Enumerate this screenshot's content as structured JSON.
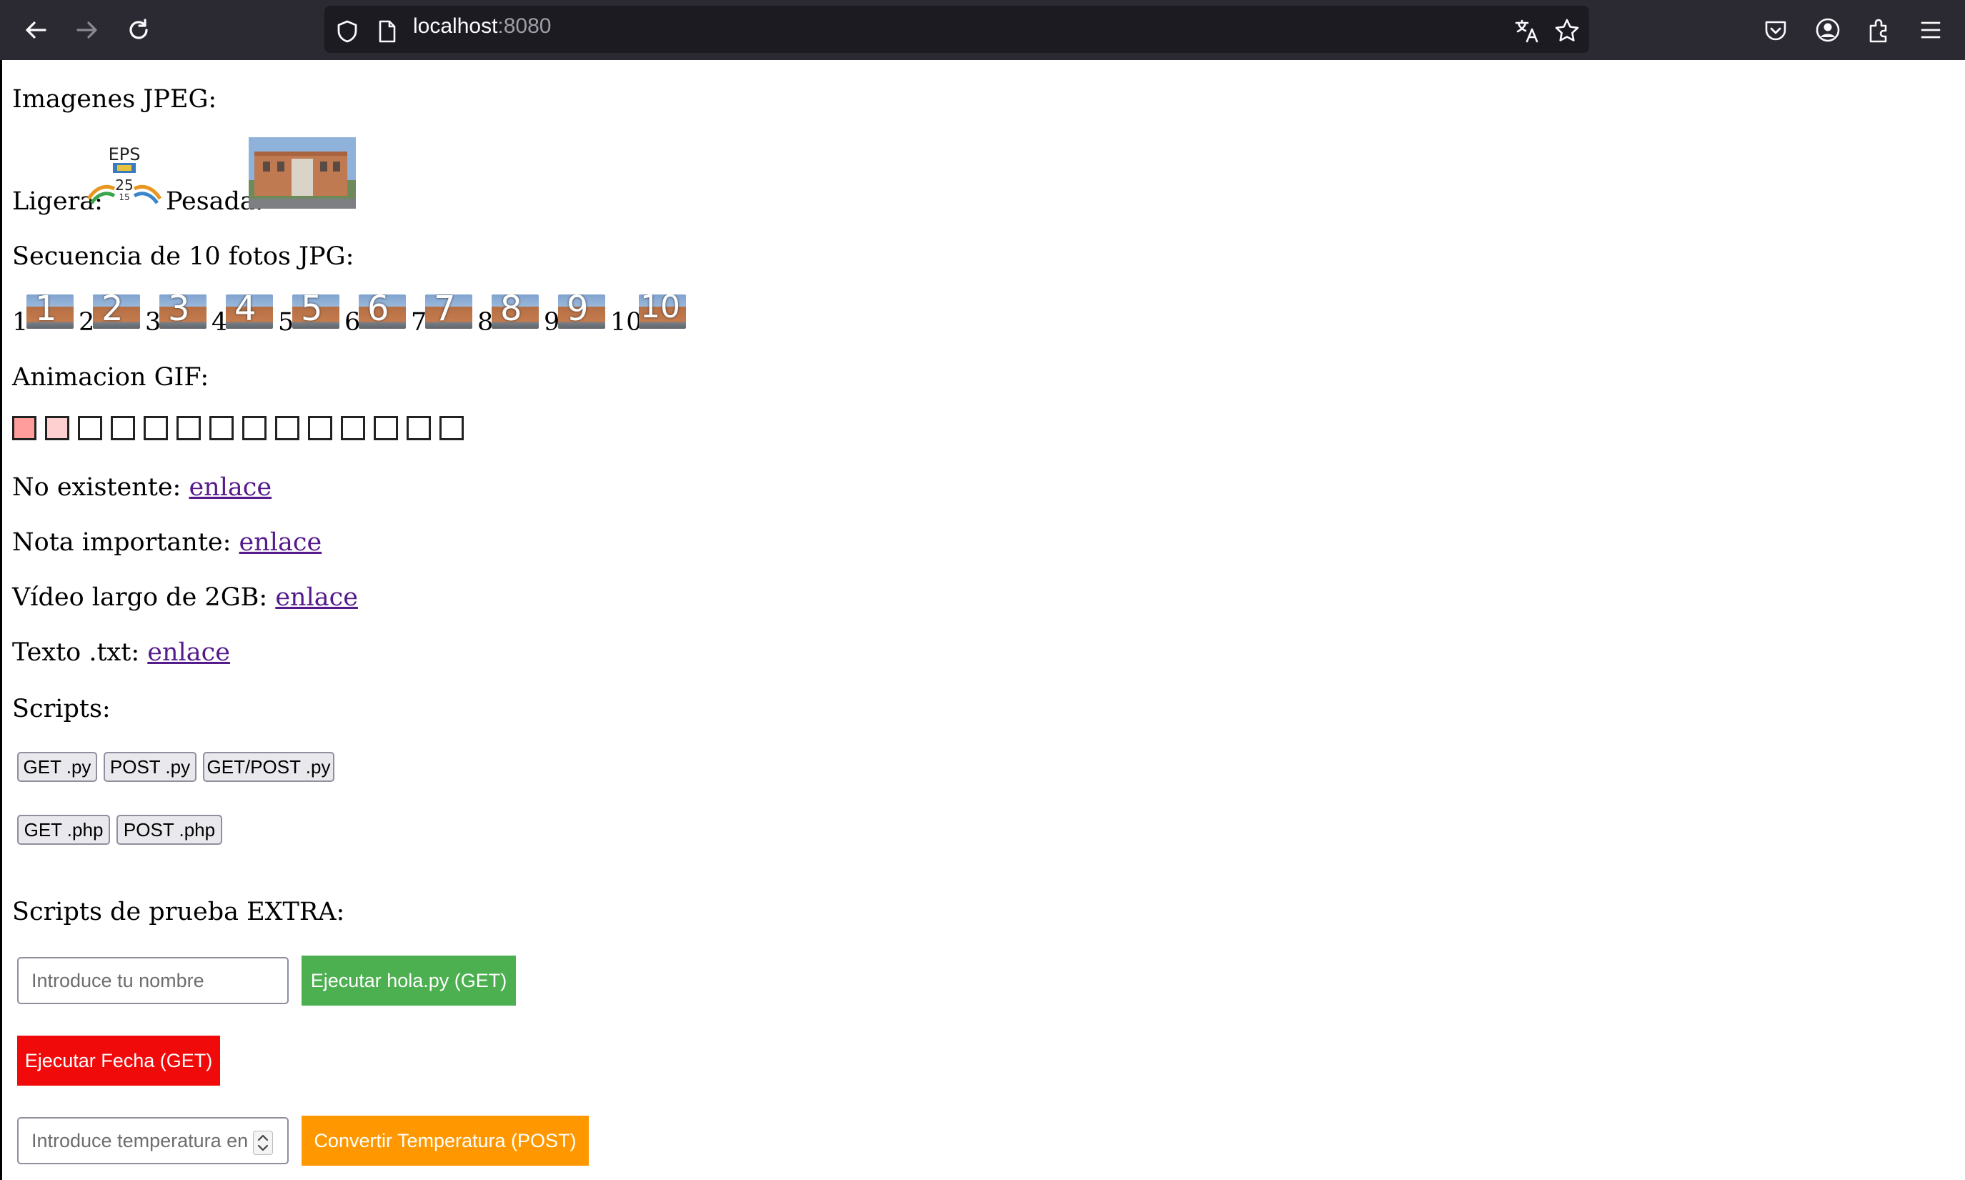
{
  "browser": {
    "url_host": "localhost",
    "url_port": ":8080"
  },
  "page": {
    "jpeg_heading": "Imagenes JPEG:",
    "light_label": "Ligera:",
    "logo_text_top": "EPS",
    "logo_text_bottom": "25",
    "logo_text_small": "15",
    "heavy_label": "Pesada:",
    "sequence_heading": "Secuencia de 10 fotos JPG:",
    "sequence": [
      {
        "label": "1",
        "overlay": "1"
      },
      {
        "label": "2",
        "overlay": "2"
      },
      {
        "label": "3",
        "overlay": "3"
      },
      {
        "label": "4",
        "overlay": "4"
      },
      {
        "label": "5",
        "overlay": "5"
      },
      {
        "label": "6",
        "overlay": "6"
      },
      {
        "label": "7",
        "overlay": "7"
      },
      {
        "label": "8",
        "overlay": "8"
      },
      {
        "label": "9",
        "overlay": "9"
      },
      {
        "label": "10",
        "overlay": "10"
      }
    ],
    "gif_heading": "Animacion GIF:",
    "gif_frames": 14,
    "gif_colors": [
      "#ff9c9c",
      "#ffd0d0"
    ],
    "links": [
      {
        "label": "No existente:",
        "link": "enlace"
      },
      {
        "label": "Nota importante:",
        "link": "enlace"
      },
      {
        "label": "Vídeo largo de 2GB:",
        "link": "enlace"
      },
      {
        "label": "Texto .txt:",
        "link": "enlace"
      }
    ],
    "scripts_heading": "Scripts:",
    "script_buttons_row1": [
      "GET .py",
      "POST .py",
      "GET/POST .py"
    ],
    "script_buttons_row2": [
      "GET .php",
      "POST .php"
    ],
    "extra_heading": "Scripts de prueba EXTRA:",
    "name_placeholder": "Introduce tu nombre",
    "hola_button": "Ejecutar hola.py (GET)",
    "fecha_button": "Ejecutar Fecha (GET)",
    "temp_placeholder": "Introduce temperatura en",
    "temp_button": "Convertir Temperatura (POST)",
    "colors": {
      "green": "#4caf50",
      "red": "#f00a0a",
      "orange": "#ff9800",
      "link": "#551a8b"
    }
  }
}
